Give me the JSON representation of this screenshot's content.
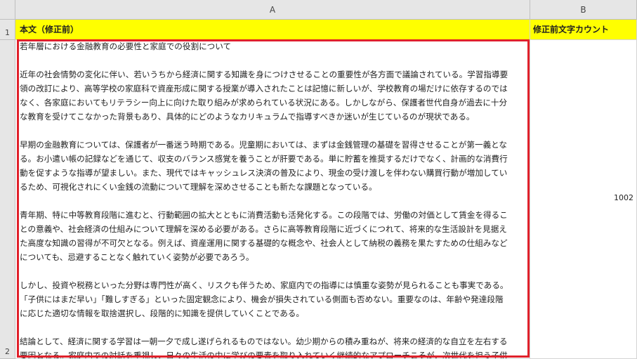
{
  "columns": [
    "A",
    "B"
  ],
  "rows": [
    "1",
    "2"
  ],
  "header": {
    "a1": "本文（修正前）",
    "b1": "修正前文字カウント"
  },
  "cell_b2": "1002",
  "body_lines": [
    "若年層における金融教育の必要性と家庭での役割について",
    "",
    "近年の社会情勢の変化に伴い、若いうちから経済に関する知識を身につけさせることの重要性が各方面で議論されている。学習指導要",
    "領の改訂により、高等学校の家庭科で資産形成に関する授業が導入されたことは記憶に新しいが、学校教育の場だけに依存するのでは",
    "なく、各家庭においてもリテラシー向上に向けた取り組みが求められている状況にある。しかしながら、保護者世代自身が過去に十分",
    "な教育を受けてこなかった背景もあり、具体的にどのようなカリキュラムで指導すべきか迷いが生じているのが現状である。",
    "",
    "早期の金融教育については、保護者が一番迷う時期である。児童期においては、まずは金銭管理の基礎を習得させることが第一義とな",
    "る。お小遣い帳の記録などを通じて、収支のバランス感覚を養うことが肝要である。単に貯蓄を推奨するだけでなく、計画的な消費行",
    "動を促すような指導が望ましい。また、現代ではキャッシュレス決済の普及により、現金の受け渡しを伴わない購買行動が増加してい",
    "るため、可視化されにくい金銭の流動について理解を深めさせることも新たな課題となっている。",
    "",
    "青年期、特に中等教育段階に進むと、行動範囲の拡大とともに消費活動も活発化する。この段階では、労働の対価として賃金を得るこ",
    "との意義や、社会経済の仕組みについて理解を深める必要がある。さらに高等教育段階に近づくにつれて、将来的な生活設計を見据え",
    "た高度な知識の習得が不可欠となる。例えば、資産運用に関する基礎的な概念や、社会人として納税の義務を果たすための仕組みなど",
    "についても、忌避することなく触れていく姿勢が必要であろう。",
    "",
    "しかし、投資や税務といった分野は専門性が高く、リスクも伴うため、家庭内での指導には慎重な姿勢が見られることも事実である。",
    "「子供にはまだ早い」「難しすぎる」といった固定観念により、機会が損失されている側面も否めない。重要なのは、年齢や発達段階",
    "に応じた適切な情報を取捨選択し、段階的に知識を提供していくことである。",
    "",
    "結論として、経済に関する学習は一朝一夕で成し遂げられるものではない。幼少期からの積み重ねが、将来の経済的な自立を左右する",
    "要因となる。家庭内での対話を重視し、日々の生活の中に学びの要素を取り入れていく継続的なアプローチこそが、次世代を担う子供"
  ]
}
